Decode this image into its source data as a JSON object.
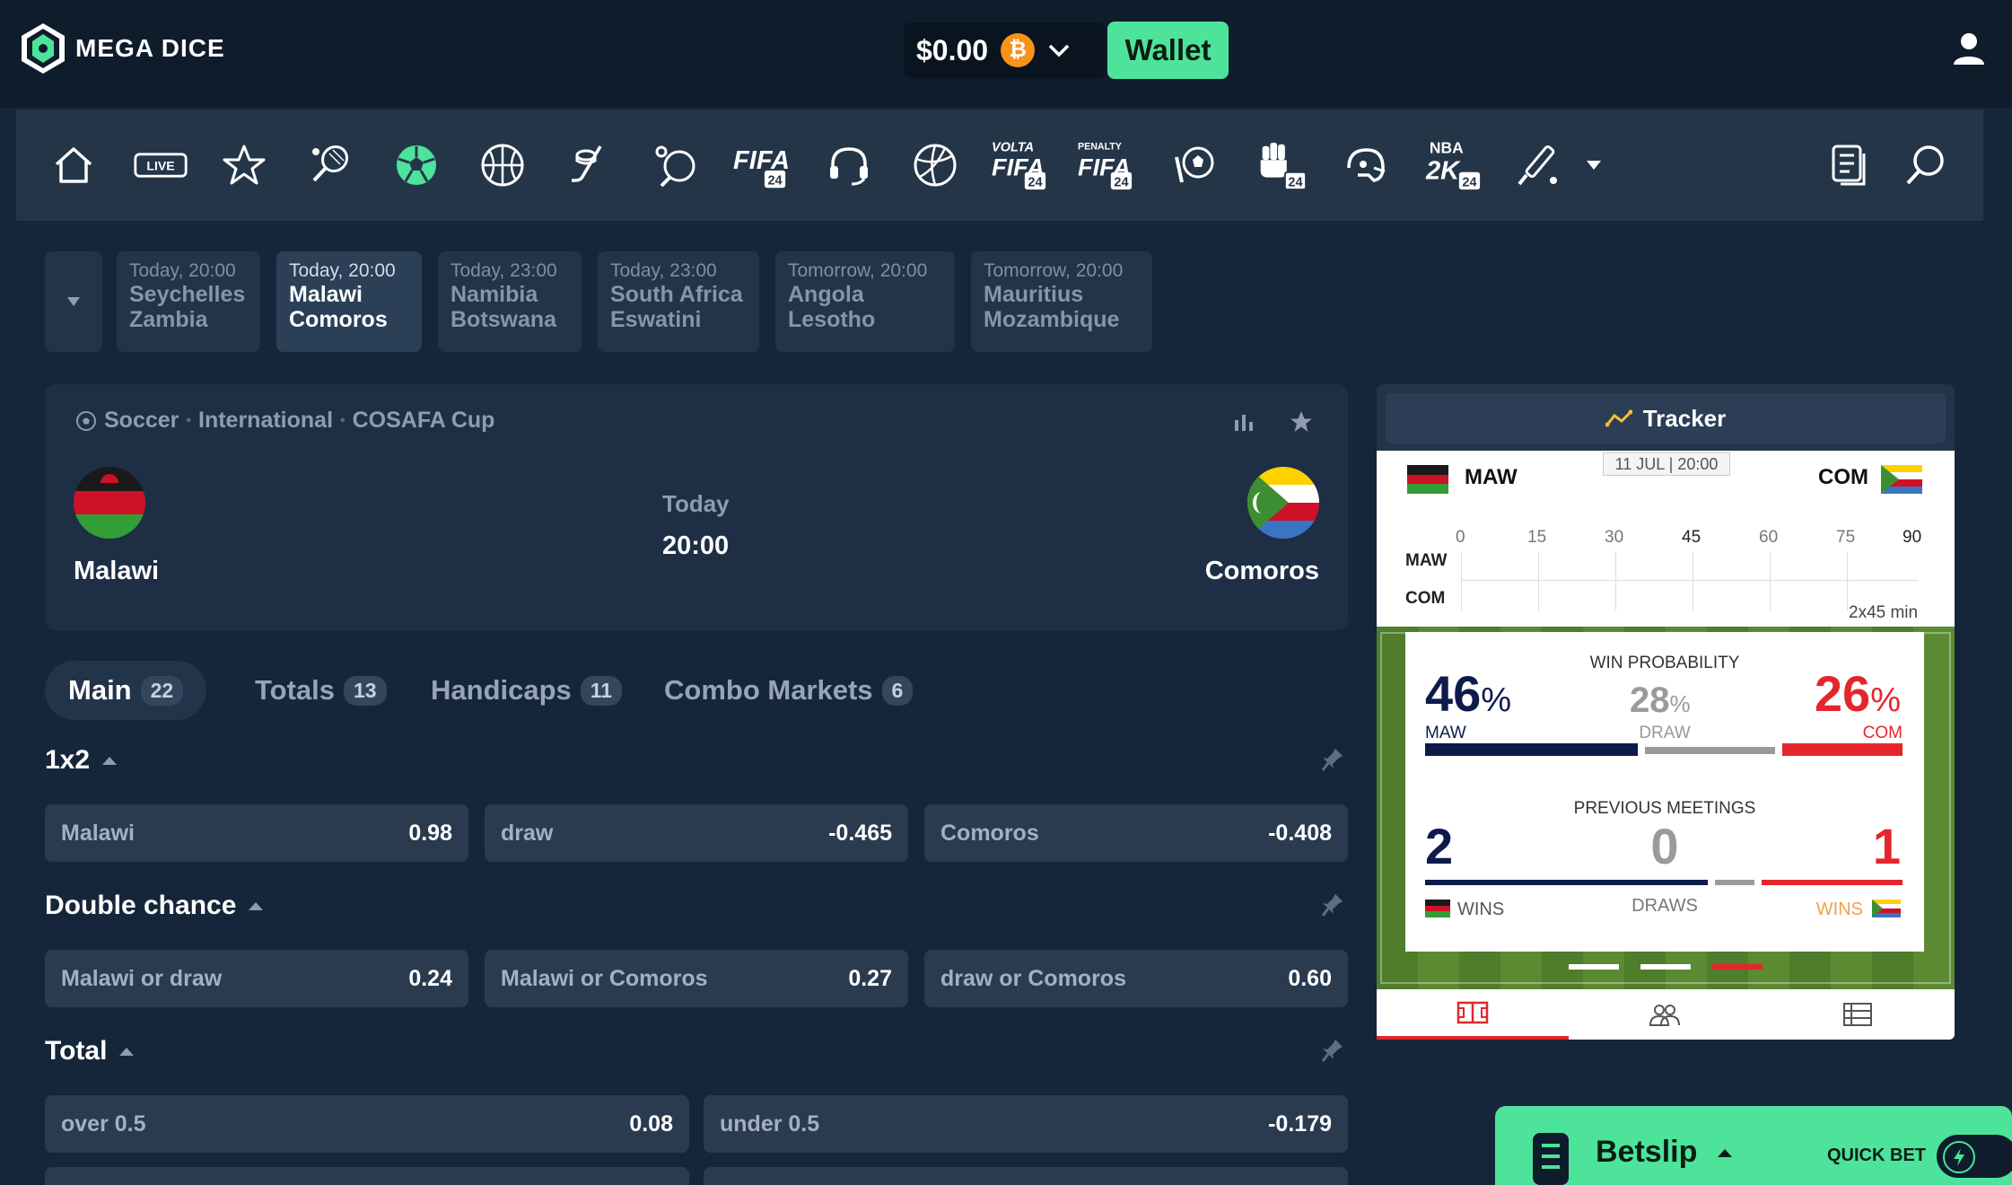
{
  "header": {
    "logo_text": "MEGA DICE",
    "balance": "$0.00",
    "currency_icon": "bitcoin-icon",
    "wallet_label": "Wallet"
  },
  "sports_nav": [
    "home-icon",
    "live-icon",
    "favorites-star-icon",
    "tennis-icon",
    "soccer-icon",
    "basketball-icon",
    "ice-hockey-icon",
    "table-tennis-icon",
    "fifa-icon",
    "esports-headset-icon",
    "volleyball-icon",
    "volta-fifa-icon",
    "penalty-fifa-icon",
    "efootball-icon",
    "mma-icon",
    "american-football-icon",
    "nba2k-icon",
    "cricket-icon",
    "more-dropdown-icon",
    "betslip-history-icon",
    "search-icon"
  ],
  "sports_labels": {
    "live": "LIVE",
    "fifa": "FIFA",
    "badge24": "24",
    "volta": "VOLTA",
    "penalty": "PENALTY",
    "nba": "NBA",
    "twok": "2K"
  },
  "upcoming": [
    {
      "time": "Today, 20:00",
      "home": "Seychelles",
      "away": "Zambia"
    },
    {
      "time": "Today, 20:00",
      "home": "Malawi",
      "away": "Comoros"
    },
    {
      "time": "Today, 23:00",
      "home": "Namibia",
      "away": "Botswana"
    },
    {
      "time": "Today, 23:00",
      "home": "South Africa",
      "away": "Eswatini"
    },
    {
      "time": "Tomorrow, 20:00",
      "home": "Angola",
      "away": "Lesotho"
    },
    {
      "time": "Tomorrow, 20:00",
      "home": "Mauritius",
      "away": "Mozambique"
    }
  ],
  "match": {
    "breadcrumb": [
      "Soccer",
      "International",
      "COSAFA Cup"
    ],
    "home": "Malawi",
    "away": "Comoros",
    "day": "Today",
    "time": "20:00"
  },
  "market_tabs": [
    {
      "label": "Main",
      "count": "22"
    },
    {
      "label": "Totals",
      "count": "13"
    },
    {
      "label": "Handicaps",
      "count": "11"
    },
    {
      "label": "Combo Markets",
      "count": "6"
    }
  ],
  "markets": {
    "m1x2": {
      "title": "1x2",
      "odds": [
        {
          "label": "Malawi",
          "value": "0.98"
        },
        {
          "label": "draw",
          "value": "-0.465"
        },
        {
          "label": "Comoros",
          "value": "-0.408"
        }
      ]
    },
    "double": {
      "title": "Double chance",
      "odds": [
        {
          "label": "Malawi or draw",
          "value": "0.24"
        },
        {
          "label": "Malawi or Comoros",
          "value": "0.27"
        },
        {
          "label": "draw or Comoros",
          "value": "0.60"
        }
      ]
    },
    "total": {
      "title": "Total",
      "odds": [
        {
          "label": "over 0.5",
          "value": "0.08"
        },
        {
          "label": "under 0.5",
          "value": "-0.179"
        }
      ]
    }
  },
  "tracker": {
    "title": "Tracker",
    "home_code": "MAW",
    "away_code": "COM",
    "date": "11 JUL | 20:00",
    "ticks": [
      "0",
      "15",
      "30",
      "45",
      "60",
      "75",
      "90"
    ],
    "duration": "2x45 min",
    "win_prob_title": "WIN PROBABILITY",
    "home_pct": "46",
    "draw_pct": "28",
    "away_pct": "26",
    "pct_sign": "%",
    "draw_label": "DRAW",
    "prev_title": "PREVIOUS MEETINGS",
    "home_wins": "2",
    "draws": "0",
    "away_wins": "1",
    "wins_label": "WINS",
    "draws_label": "DRAWS"
  },
  "betslip": {
    "label": "Betslip",
    "quick_bet": "QUICK BET"
  },
  "colors": {
    "accent": "#4de39a",
    "home_bar": "#0d1b4b",
    "away_bar": "#e4262c",
    "draw_bar": "#9a9a9a"
  }
}
